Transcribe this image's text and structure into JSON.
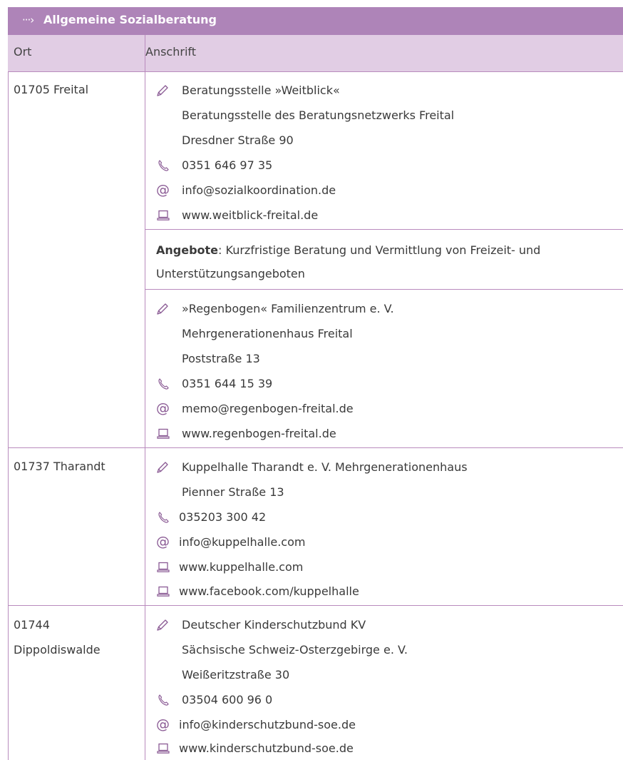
{
  "header": {
    "arrow": "···›",
    "title": "Allgemeine Sozialberatung"
  },
  "columns": {
    "ort": "Ort",
    "anschrift": "Anschrift"
  },
  "rows": [
    {
      "ort_line1": "01705 Freital",
      "entry1": {
        "name": "Beratungsstelle »Weitblick«",
        "line2": "Beratungsstelle des Beratungsnetzwerks Freital",
        "line3": "Dresdner Straße 90",
        "phone": "0351 646 97 35",
        "email": "info@sozialkoordination.de",
        "web": "www.weitblick-freital.de"
      },
      "angebote_label": "Angebote",
      "angebote_text_1": ": Kurzfristige Beratung und Vermittlung von Freizeit- und",
      "angebote_text_2": "Unterstützungsangeboten",
      "entry2": {
        "name": "»Regenbogen« Familienzentrum e. V.",
        "line2": "Mehrgenerationenhaus Freital",
        "line3": "Poststraße 13",
        "phone": "0351 644 15 39",
        "email": "memo@regenbogen-freital.de",
        "web": "www.regenbogen-freital.de"
      }
    },
    {
      "ort_line1": "01737 Tharandt",
      "entry1": {
        "name": "Kuppelhalle Tharandt e. V. Mehrgenerationenhaus",
        "line2": "Pienner Straße 13",
        "phone": "035203 300 42",
        "email": "info@kuppelhalle.com",
        "web": "www.kuppelhalle.com",
        "web2": "www.facebook.com/kuppelhalle"
      }
    },
    {
      "ort_line1": "01744",
      "ort_line2": "Dippoldiswalde",
      "entry1": {
        "name": "Deutscher Kinderschutzbund KV",
        "line2": "Sächsische Schweiz-Osterzgebirge e. V.",
        "line3": "Weißeritzstraße 30",
        "phone": "03504 600 96 0",
        "email": "info@kinderschutzbund-soe.de",
        "web": "www.kinderschutzbund-soe.de"
      }
    }
  ],
  "colors": {
    "header_bg": "#ae84b8",
    "subheader_bg": "#e1cde4",
    "rule": "#b98bbd",
    "icon": "#8a5a94"
  },
  "icons": {
    "name": "pencil-icon",
    "phone": "phone-icon",
    "email": "at-icon",
    "web": "laptop-icon"
  }
}
